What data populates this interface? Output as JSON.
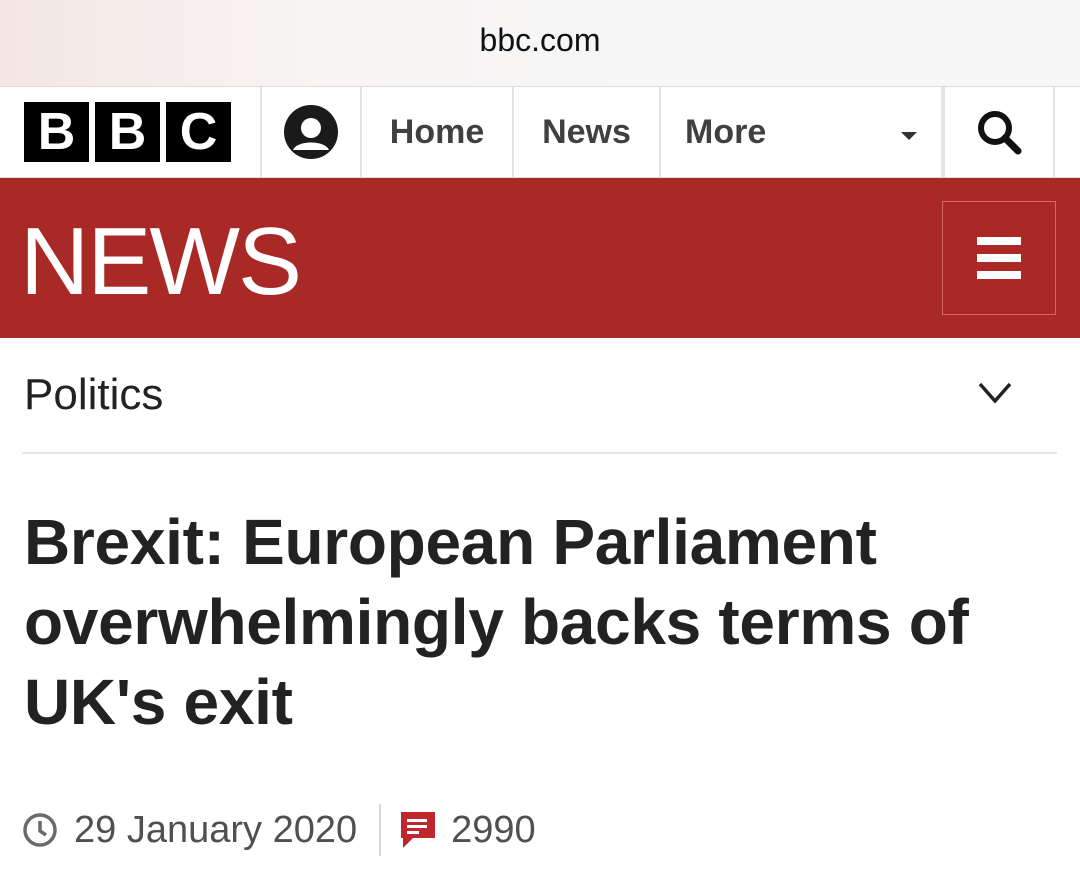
{
  "browser": {
    "address": "bbc.com"
  },
  "nav": {
    "logo_letters": [
      "B",
      "B",
      "C"
    ],
    "home_label": "Home",
    "news_label": "News",
    "more_label": "More"
  },
  "brand": {
    "wordmark": "NEWS",
    "band_color": "#a92926"
  },
  "section": {
    "label": "Politics"
  },
  "article": {
    "headline": "Brexit: European Parliament overwhelmingly backs terms of UK's exit",
    "date": "29 January 2020",
    "comment_count": "2990"
  },
  "icons": {
    "account": "account-icon",
    "caret": "caret-down-icon",
    "search": "search-icon",
    "menu": "hamburger-menu-icon",
    "chevron": "chevron-down-icon",
    "clock": "clock-icon",
    "comments": "comment-icon"
  },
  "colors": {
    "comment_icon": "#c0272d",
    "logo_block": "#000000"
  }
}
